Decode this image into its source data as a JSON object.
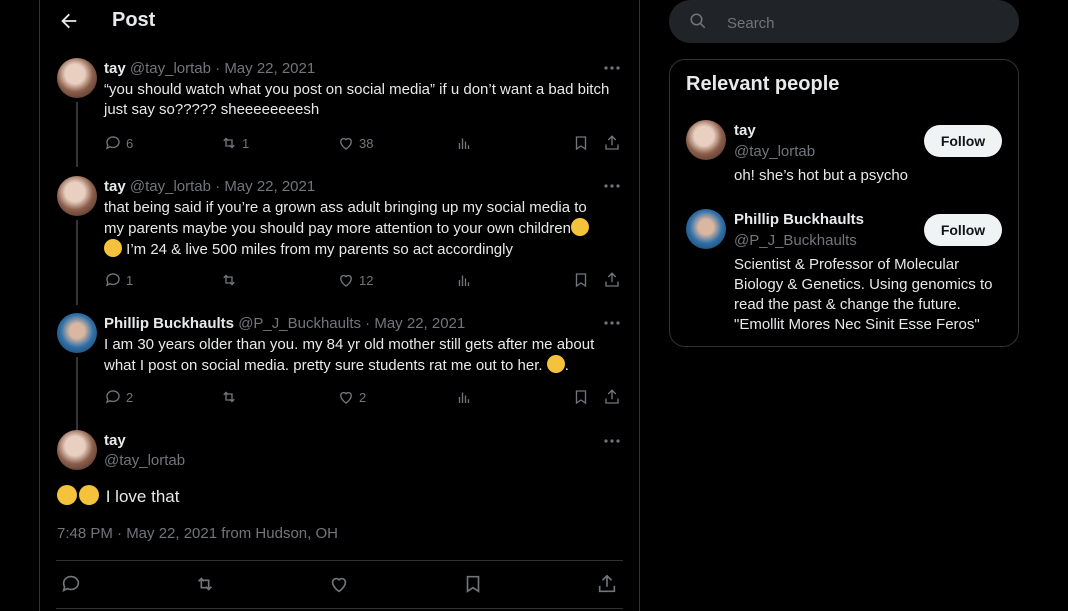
{
  "header": {
    "title": "Post"
  },
  "tweets": [
    {
      "name": "tay",
      "handle": "@tay_lortab",
      "date": "May 22, 2021",
      "text": "“you should watch what you post on social media” if u don’t want a bad bitch just say so????? sheeeeeeeesh",
      "replies": "6",
      "reposts": "1",
      "likes": "38"
    },
    {
      "name": "tay",
      "handle": "@tay_lortab",
      "date": "May 22, 2021",
      "text_line1": "that being said if you’re a grown ass adult bringing up my social media to",
      "text_line2": "my parents maybe you should pay more attention to your own children",
      "text_line3": "I’m 24 & live 500 miles from my parents so act accordingly",
      "replies": "1",
      "reposts": "",
      "likes": "12"
    },
    {
      "name": "Phillip Buckhaults",
      "handle": "@P_J_Buckhaults",
      "date": "May 22, 2021",
      "text_line1": "I am 30 years older than you.  my 84 yr old mother still gets after me about",
      "text_line2": "what I post on social media.   pretty sure students rat me out to her.",
      "text_line2_end": ".",
      "replies": "2",
      "reposts": "",
      "likes": "2"
    }
  ],
  "main_post": {
    "name": "tay",
    "handle": "@tay_lortab",
    "text": "I love that",
    "timestamp": "7:48 PM · May 22, 2021 from Hudson, OH"
  },
  "search": {
    "placeholder": "Search"
  },
  "relevant": {
    "title": "Relevant people",
    "people": [
      {
        "name": "tay",
        "handle": "@tay_lortab",
        "bio": "oh! she’s hot but a psycho",
        "follow": "Follow"
      },
      {
        "name": "Phillip Buckhaults",
        "handle": "@P_J_Buckhaults",
        "bio": "Scientist & Professor of Molecular Biology & Genetics. Using genomics to read the past & change the future. \"Emollit Mores Nec Sinit Esse Feros\"",
        "follow": "Follow"
      }
    ]
  },
  "colors": {
    "background": "#000000",
    "text": "#e7e9ea",
    "muted": "#71767b",
    "border": "#2f3336",
    "button_bg": "#eff3f4"
  }
}
